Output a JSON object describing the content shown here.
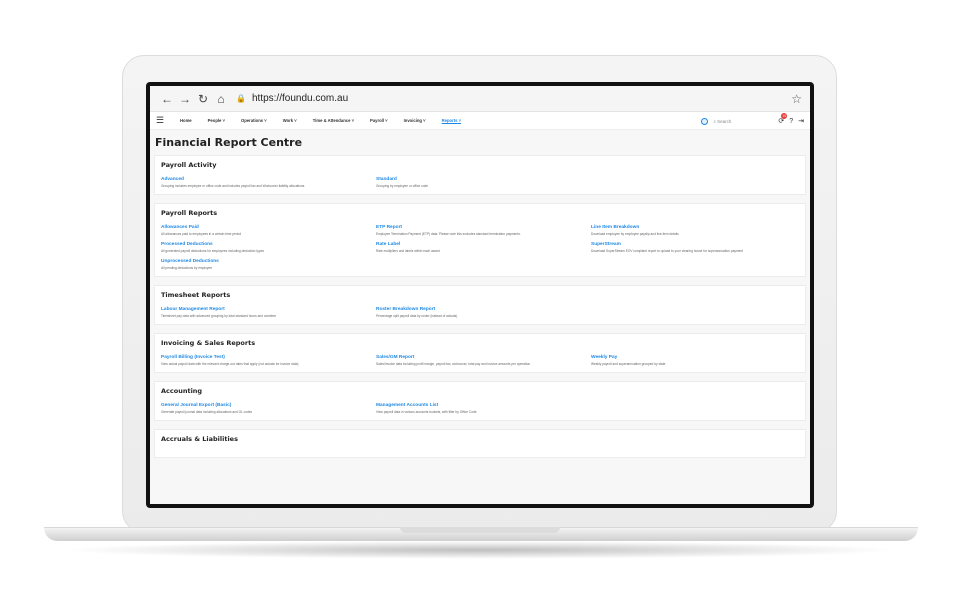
{
  "browser": {
    "url": "https://foundu.com.au",
    "icons": [
      "back-icon",
      "forward-icon",
      "reload-icon",
      "home-icon",
      "lock-icon",
      "star-icon"
    ]
  },
  "nav": {
    "items": [
      {
        "label": "Home"
      },
      {
        "label": "People"
      },
      {
        "label": "Operations"
      },
      {
        "label": "Work"
      },
      {
        "label": "Time & Attendance"
      },
      {
        "label": "Payroll"
      },
      {
        "label": "Invoicing"
      },
      {
        "label": "Reports"
      }
    ],
    "search_placeholder": "Search",
    "notification_count": "10"
  },
  "page": {
    "title": "Financial Report Centre"
  },
  "sections": [
    {
      "title": "Payroll Activity",
      "items": [
        {
          "label": "Advanced",
          "desc": "Grouping includes employee or office code and includes payroll tax and Workcover liability allocations."
        },
        {
          "label": "Standard",
          "desc": "Grouping by employee or office code"
        }
      ]
    },
    {
      "title": "Payroll Reports",
      "items": [
        {
          "label": "Allowances Paid",
          "desc": "All allowances paid to employees in a certain time period"
        },
        {
          "label": "ETP Report",
          "desc": "Employee Termination Payment (ETP) data. Please note this excludes standard termination payments."
        },
        {
          "label": "Line Item Breakdown",
          "desc": "Download employee by employee payslip and line item details"
        },
        {
          "label": "Processed Deductions",
          "desc": "All generated payroll deductions for employees including deduction types"
        },
        {
          "label": "Rate Label",
          "desc": "Rate multipliers and labels within each award"
        },
        {
          "label": "SuperStream",
          "desc": "Download SuperStream EOV compliant report to upload to your clearing house for superannuation payment"
        },
        {
          "label": "Unprocessed Deductions",
          "desc": "All pending deductions by employee"
        }
      ]
    },
    {
      "title": "Timesheet Reports",
      "items": [
        {
          "label": "Labour Management Report",
          "desc": "Timesheet pay data with advanced grouping by total standard hours and overtime"
        },
        {
          "label": "Roster Breakdown Report",
          "desc": "Percentage split payroll data by roster (instead of actuals)"
        }
      ]
    },
    {
      "title": "Invoicing & Sales Reports",
      "items": [
        {
          "label": "Payroll Billing (Invoice Test)",
          "desc": "View actual payroll data with the relevant charge-out rates that apply (not actuals for invoice data)"
        },
        {
          "label": "Sales/GM Report",
          "desc": "Sales/Invoice data including profit margin, payroll tax, workcover, total pay and invoice amounts per operation"
        },
        {
          "label": "Weekly Pay",
          "desc": "Weekly payroll and superannuation grouped by state"
        }
      ]
    },
    {
      "title": "Accounting",
      "items": [
        {
          "label": "General Journal Export (Basic)",
          "desc": "Generate payroll journal data including allocations and GL codes"
        },
        {
          "label": "Management Accounts List",
          "desc": "View payroll data in various accounts buckets, with filter by Office Code"
        }
      ]
    },
    {
      "title": "Accruals & Liabilities",
      "items": []
    }
  ]
}
